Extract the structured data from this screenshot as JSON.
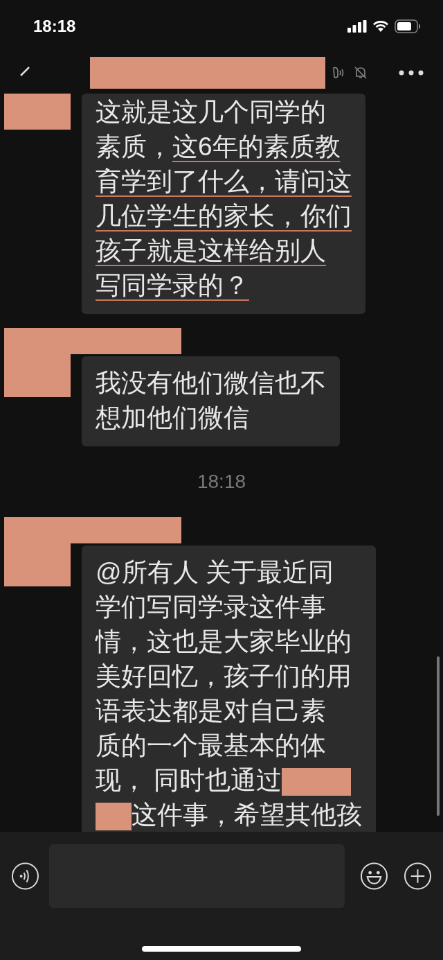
{
  "status_bar": {
    "time": "18:18"
  },
  "messages": [
    {
      "name_redacted": false,
      "lines": [
        [
          {
            "text": "这就是这几个同学的",
            "underlined": false
          }
        ],
        [
          {
            "text": "素质，",
            "underlined": false
          },
          {
            "text": "这6年的素质教",
            "underlined": true
          }
        ],
        [
          {
            "text": "育学到了什么，请问这",
            "underlined": true
          }
        ],
        [
          {
            "text": "几位学生的家长，你们",
            "underlined": true
          }
        ],
        [
          {
            "text": "孩子就是这样给别人",
            "underlined": true
          }
        ],
        [
          {
            "text": "写同学录的？",
            "underlined": true
          }
        ]
      ]
    },
    {
      "name_redacted": true,
      "lines": [
        [
          {
            "text": "我没有他们微信也不"
          }
        ],
        [
          {
            "text": "想加他们微信"
          }
        ]
      ]
    },
    {
      "kind": "time",
      "text": "18:18"
    },
    {
      "name_redacted": true,
      "lines": [
        [
          {
            "text": "@所有人 关于最近同"
          }
        ],
        [
          {
            "text": "学们写同学录这件事"
          }
        ],
        [
          {
            "text": "情，这也是大家毕业的"
          }
        ],
        [
          {
            "text": "美好回忆，孩子们的用"
          }
        ],
        [
          {
            "text": "语表达都是对自己素"
          }
        ],
        [
          {
            "text": "质的一个最基本的体"
          }
        ],
        [
          {
            "text": "现， 同时也通过"
          },
          {
            "kind": "redaction"
          }
        ],
        [
          {
            "kind": "redaction"
          },
          {
            "text": "这件事，希望其他孩"
          }
        ]
      ]
    }
  ]
}
